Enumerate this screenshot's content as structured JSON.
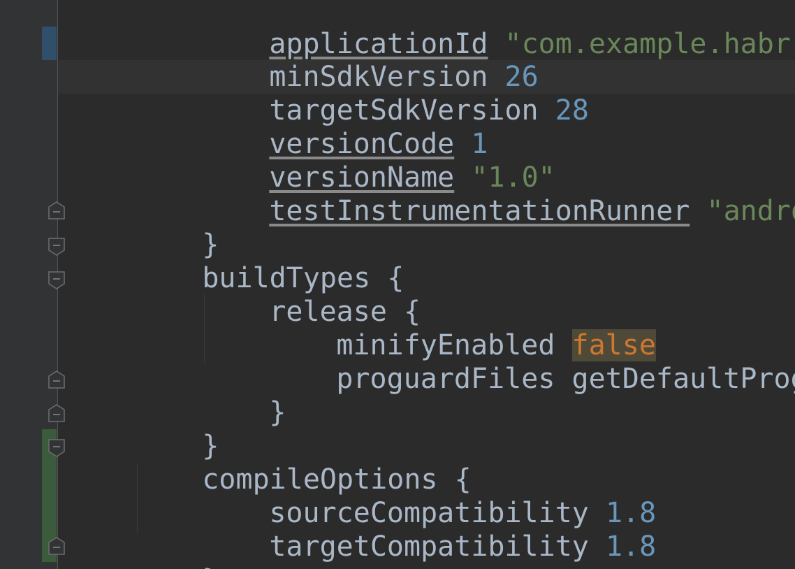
{
  "lines": [
    {
      "ident": "applicationId",
      "value": "\"com.example.habr.awes"
    },
    {
      "ident": "minSdkVersion",
      "value": "26"
    },
    {
      "ident": "targetSdkVersion",
      "value": "28"
    },
    {
      "ident": "versionCode",
      "value": "1"
    },
    {
      "ident": "versionName",
      "value": "\"1.0\""
    },
    {
      "ident": "testInstrumentationRunner",
      "value": "\"android.s"
    },
    {
      "ident": "}"
    },
    {
      "ident": "buildTypes",
      "brace": "{"
    },
    {
      "ident": "release",
      "brace": "{"
    },
    {
      "ident": "minifyEnabled",
      "value": "false"
    },
    {
      "ident": "proguardFiles",
      "value": "getDefaultProguard"
    },
    {
      "ident": "}"
    },
    {
      "ident": "}"
    },
    {
      "ident": "compileOptions",
      "brace": "{"
    },
    {
      "ident": "sourceCompatibility",
      "value": "1.8"
    },
    {
      "ident": "targetCompatibility",
      "value": "1.8"
    },
    {
      "ident": "}"
    }
  ],
  "colors": {
    "background": "#2b2b2b",
    "gutter": "#313335",
    "identifier": "#a9b7c6",
    "number": "#6897bb",
    "string": "#6a8759",
    "keyword": "#cc7832",
    "keyword_highlight": "#4f4a37",
    "vcs_modified": "#2f4f6a",
    "vcs_added": "#3c5a3c"
  }
}
